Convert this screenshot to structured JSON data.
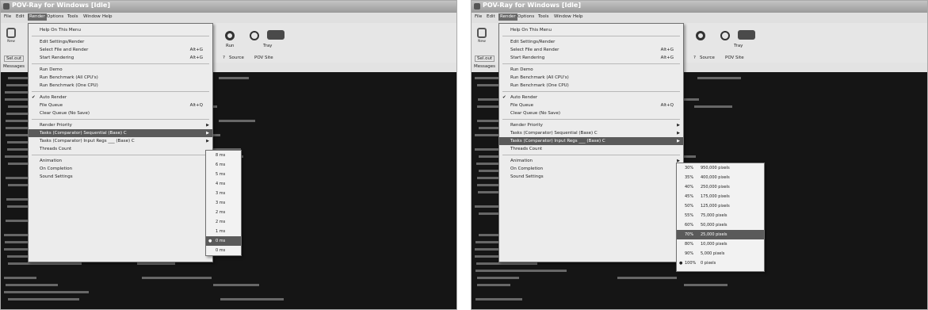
{
  "window": {
    "title": "POV-Ray for Windows [Idle]"
  },
  "menubar": [
    "File",
    "Edit",
    "Render",
    "Options",
    "Tools",
    "Window",
    "Help"
  ],
  "toolbar": {
    "new_label": "New",
    "run_label": "Run",
    "tray_label": "Tray",
    "sel_label": "Sel.out",
    "source_label": "Source",
    "site_label": "POV Site"
  },
  "messages_tab": "Messages",
  "render_menu": {
    "items": [
      {
        "label": "Help On This Menu",
        "shortcut": "",
        "submenu": false,
        "checked": false
      },
      {
        "sep": true
      },
      {
        "label": "Edit Settings/Render",
        "shortcut": "",
        "submenu": false,
        "checked": false
      },
      {
        "label": "Select File and Render",
        "shortcut": "Alt+G",
        "submenu": false,
        "checked": false
      },
      {
        "label": "Start Rendering",
        "shortcut": "Alt+G",
        "submenu": false,
        "checked": false
      },
      {
        "sep": true
      },
      {
        "label": "Run Demo",
        "shortcut": "",
        "submenu": false,
        "checked": false
      },
      {
        "label": "Run Benchmark (All CPU's)",
        "shortcut": "",
        "submenu": false,
        "checked": false
      },
      {
        "label": "Run Benchmark (One CPU)",
        "shortcut": "",
        "submenu": false,
        "checked": false
      },
      {
        "sep": true
      },
      {
        "label": "Auto Render",
        "shortcut": "",
        "submenu": false,
        "checked": true
      },
      {
        "label": "File Queue",
        "shortcut": "Alt+Q",
        "submenu": false,
        "checked": false
      },
      {
        "label": "Clear Queue (No Save)",
        "shortcut": "",
        "submenu": false,
        "checked": false
      },
      {
        "sep": true
      },
      {
        "label": "Render Priority",
        "shortcut": "",
        "submenu": true,
        "checked": false
      },
      {
        "label": "Tasks (Comparator) Sequential (Base) C",
        "shortcut": "",
        "submenu": true,
        "checked": false
      },
      {
        "label": "Tasks (Comparator) Input Regs ___ (Base) C",
        "shortcut": "",
        "submenu": true,
        "checked": false
      },
      {
        "label": "Threads Count",
        "shortcut": "",
        "submenu": false,
        "checked": false
      },
      {
        "sep": true
      },
      {
        "label": "Animation",
        "shortcut": "",
        "submenu": true,
        "checked": false
      },
      {
        "label": "On Completion",
        "shortcut": "",
        "submenu": true,
        "checked": false
      },
      {
        "label": "Sound Settings",
        "shortcut": "",
        "submenu": false,
        "checked": false
      }
    ]
  },
  "submenu_left": [
    "8 ms",
    "6 ms",
    "5 ms",
    "4 ms",
    "3 ms",
    "3 ms",
    "2 ms",
    "2 ms",
    "1 ms",
    "0 ms",
    "0 ms"
  ],
  "submenu_left_selected_index": 9,
  "submenu_right": [
    {
      "pct": "30%",
      "px": "950,000 pixels"
    },
    {
      "pct": "35%",
      "px": "400,000 pixels"
    },
    {
      "pct": "40%",
      "px": "250,000 pixels"
    },
    {
      "pct": "45%",
      "px": "175,000 pixels"
    },
    {
      "pct": "50%",
      "px": "125,000 pixels"
    },
    {
      "pct": "55%",
      "px": "75,000 pixels"
    },
    {
      "pct": "60%",
      "px": "50,000 pixels"
    },
    {
      "pct": "70%",
      "px": "25,000 pixels"
    },
    {
      "pct": "80%",
      "px": "10,000 pixels"
    },
    {
      "pct": "90%",
      "px": "5,000 pixels"
    },
    {
      "pct": "100%",
      "px": "0 pixels"
    }
  ],
  "submenu_right_selected_index": 7,
  "submenu_right_checked_index": 10
}
